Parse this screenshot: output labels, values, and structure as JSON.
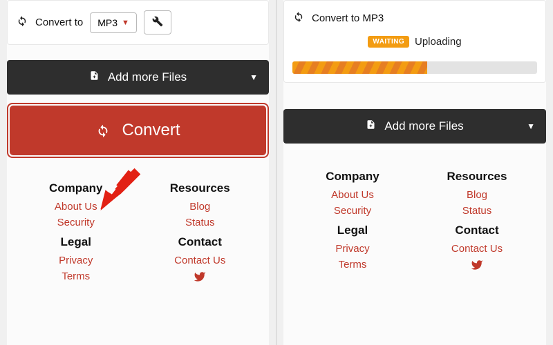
{
  "left": {
    "card": {
      "convert_label": "Convert to",
      "format": "MP3"
    },
    "add_more": "Add more Files",
    "convert_btn": "Convert",
    "footer": {
      "company": {
        "head": "Company",
        "about": "About Us",
        "security": "Security"
      },
      "resources": {
        "head": "Resources",
        "blog": "Blog",
        "status": "Status"
      },
      "legal": {
        "head": "Legal",
        "privacy": "Privacy",
        "terms": "Terms"
      },
      "contact": {
        "head": "Contact",
        "contact_us": "Contact Us"
      }
    }
  },
  "right": {
    "card": {
      "convert_label": "Convert to MP3",
      "waiting_badge": "WAITING",
      "uploading": "Uploading",
      "progress_pct": 55
    },
    "add_more": "Add more Files",
    "footer": {
      "company": {
        "head": "Company",
        "about": "About Us",
        "security": "Security"
      },
      "resources": {
        "head": "Resources",
        "blog": "Blog",
        "status": "Status"
      },
      "legal": {
        "head": "Legal",
        "privacy": "Privacy",
        "terms": "Terms"
      },
      "contact": {
        "head": "Contact",
        "contact_us": "Contact Us"
      }
    }
  },
  "colors": {
    "accent": "#c0392b",
    "dark": "#2e2e2e",
    "warn": "#f39c12"
  }
}
